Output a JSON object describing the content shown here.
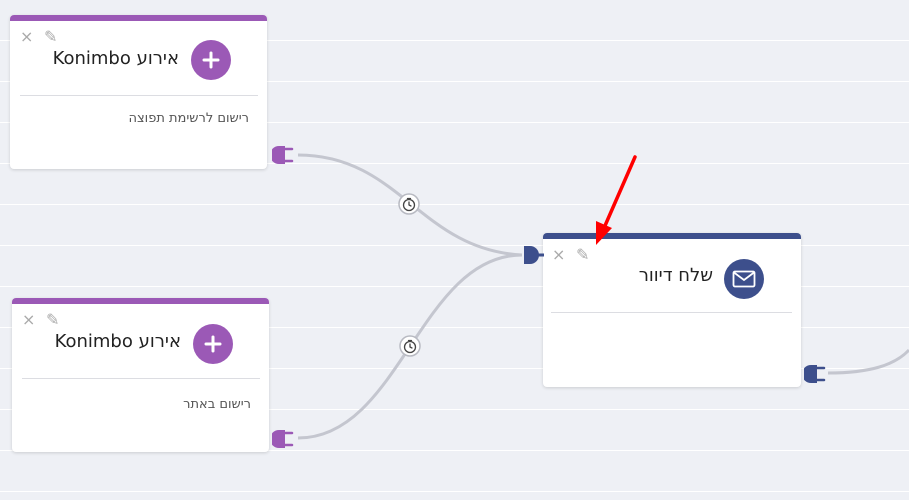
{
  "nodes": {
    "event1": {
      "title": "אירוע Konimbo",
      "subtitle": "רישום לרשימת תפוצה",
      "close_glyph": "×",
      "edit_glyph": "✎"
    },
    "event2": {
      "title": "אירוע Konimbo",
      "subtitle": "רישום באתר",
      "close_glyph": "×",
      "edit_glyph": "✎"
    },
    "send": {
      "title": "שלח דיוור",
      "close_glyph": "×",
      "edit_glyph": "✎"
    }
  },
  "icons": {
    "event_icon": "plus-icon",
    "send_icon": "envelope-icon",
    "connector": "plug-icon",
    "delay": "timer-icon",
    "annotation": "red-arrow"
  },
  "colors": {
    "event_accent": "#9b59b6",
    "send_accent": "#3d4f8c",
    "wire": "#c4c6cf",
    "annotation": "#ff0000",
    "background": "#eef0f5"
  }
}
